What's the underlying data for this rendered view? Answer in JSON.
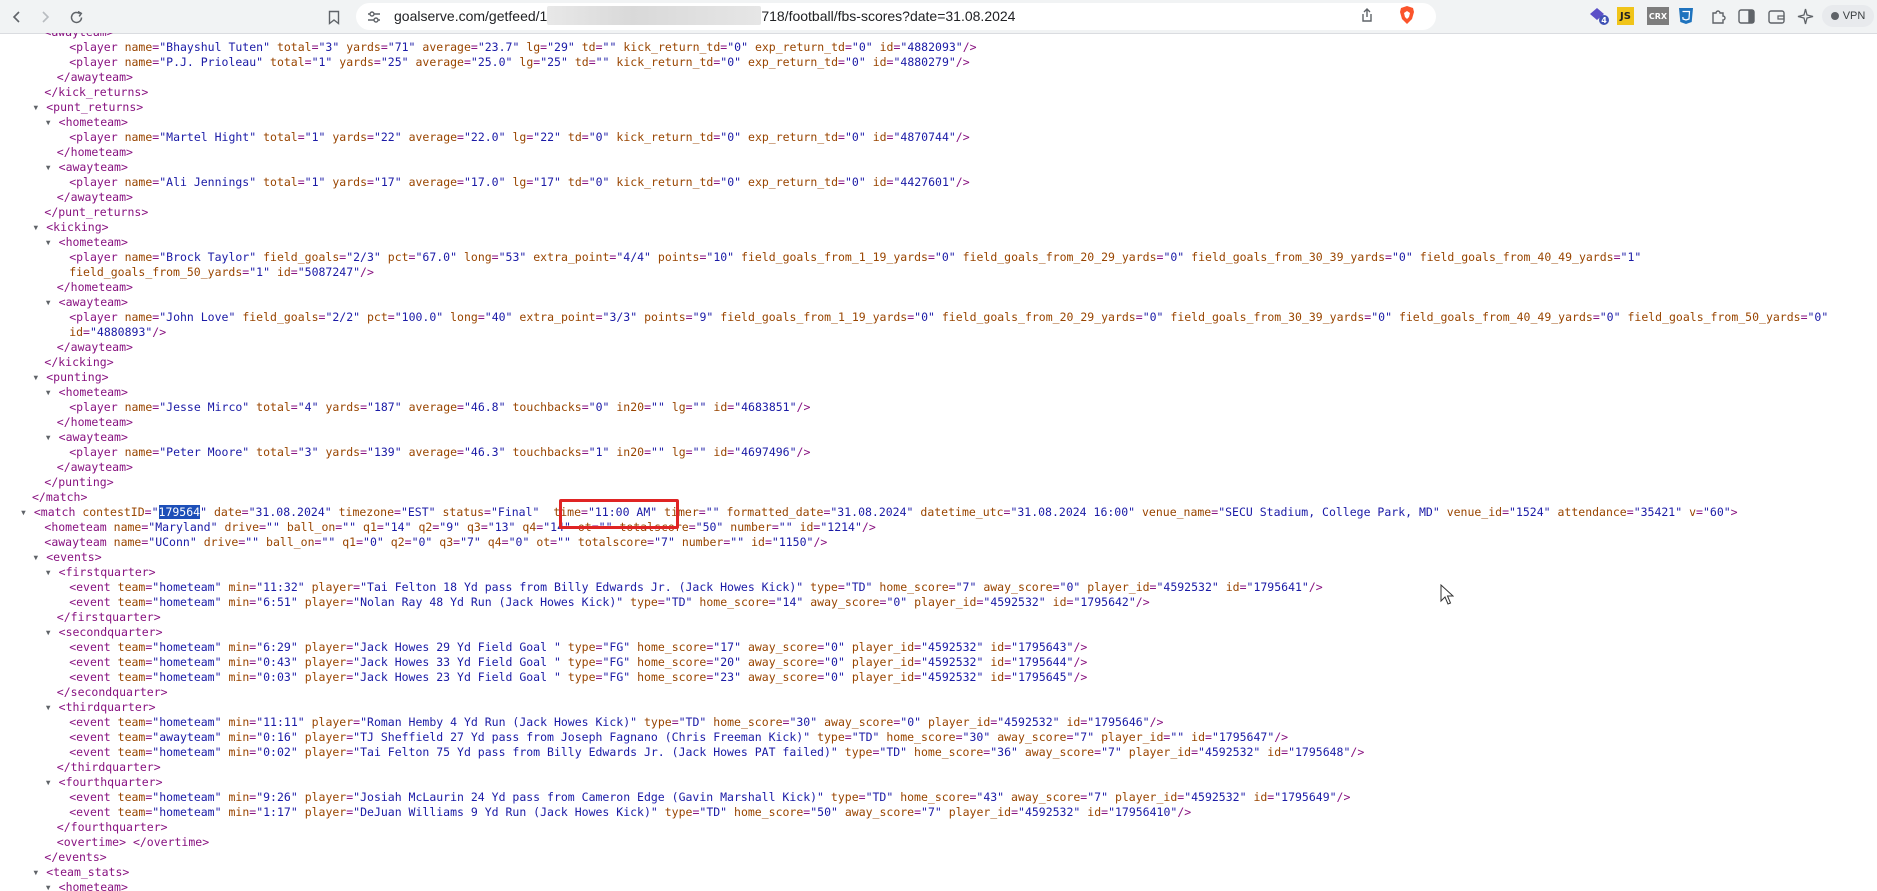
{
  "browser": {
    "url_prefix": "goalserve.com/getfeed/1",
    "url_suffix": "718/football/fbs-scores?date=31.08.2024",
    "extensions": [
      {
        "name": "extension-badge-icon",
        "badge": "4",
        "color": "#5b4fc7"
      },
      {
        "name": "js-extension-icon",
        "label": "JS",
        "color": "#f0c419"
      },
      {
        "name": "crx-extension-icon",
        "label": "CRX",
        "color": "#7d7d7d"
      },
      {
        "name": "css3-extension-icon",
        "color": "#1e73be"
      },
      {
        "name": "puzzle-extensions-icon",
        "color": "#5f6368"
      },
      {
        "name": "sidebar-icon",
        "color": "#5f6368"
      },
      {
        "name": "wallet-icon",
        "color": "#5f6368"
      },
      {
        "name": "leo-ai-icon",
        "color": "#5f6368"
      }
    ],
    "vpn_label": "VPN"
  },
  "xml_lines": [
    {
      "indent": 4,
      "text": "<awayteam>",
      "cut": true
    },
    {
      "indent": 6,
      "text": "<player name=\"Bhayshul Tuten\" total=\"3\" yards=\"71\" average=\"23.7\" lg=\"29\" td=\"\" kick_return_td=\"0\" exp_return_td=\"0\" id=\"4882093\"/>"
    },
    {
      "indent": 6,
      "text": "<player name=\"P.J. Prioleau\" total=\"1\" yards=\"25\" average=\"25.0\" lg=\"25\" td=\"\" kick_return_td=\"0\" exp_return_td=\"0\" id=\"4880279\"/>"
    },
    {
      "indent": 5,
      "text": "</awayteam>"
    },
    {
      "indent": 4,
      "text": "</kick_returns>"
    },
    {
      "indent": 4,
      "text": "<punt_returns>",
      "tri": true
    },
    {
      "indent": 5,
      "text": "<hometeam>",
      "tri": true
    },
    {
      "indent": 6,
      "text": "<player name=\"Martel Hight\" total=\"1\" yards=\"22\" average=\"22.0\" lg=\"22\" td=\"0\" kick_return_td=\"0\" exp_return_td=\"0\" id=\"4870744\"/>"
    },
    {
      "indent": 5,
      "text": "</hometeam>"
    },
    {
      "indent": 5,
      "text": "<awayteam>",
      "tri": true
    },
    {
      "indent": 6,
      "text": "<player name=\"Ali Jennings\" total=\"1\" yards=\"17\" average=\"17.0\" lg=\"17\" td=\"0\" kick_return_td=\"0\" exp_return_td=\"0\" id=\"4427601\"/>"
    },
    {
      "indent": 5,
      "text": "</awayteam>"
    },
    {
      "indent": 4,
      "text": "</punt_returns>"
    },
    {
      "indent": 4,
      "text": "<kicking>",
      "tri": true
    },
    {
      "indent": 5,
      "text": "<hometeam>",
      "tri": true
    },
    {
      "indent": 6,
      "text": "<player name=\"Brock Taylor\" field_goals=\"2/3\" pct=\"67.0\" long=\"53\" extra_point=\"4/4\" points=\"10\" field_goals_from_1_19_yards=\"0\" field_goals_from_20_29_yards=\"0\" field_goals_from_30_39_yards=\"0\" field_goals_from_40_49_yards=\"1\""
    },
    {
      "indent": 6,
      "text": "field_goals_from_50_yards=\"1\" id=\"5087247\"/>"
    },
    {
      "indent": 5,
      "text": "</hometeam>"
    },
    {
      "indent": 5,
      "text": "<awayteam>",
      "tri": true
    },
    {
      "indent": 6,
      "text": "<player name=\"John Love\" field_goals=\"2/2\" pct=\"100.0\" long=\"40\" extra_point=\"3/3\" points=\"9\" field_goals_from_1_19_yards=\"0\" field_goals_from_20_29_yards=\"0\" field_goals_from_30_39_yards=\"0\" field_goals_from_40_49_yards=\"0\" field_goals_from_50_yards=\"0\""
    },
    {
      "indent": 6,
      "text": "id=\"4880893\"/>"
    },
    {
      "indent": 5,
      "text": "</awayteam>"
    },
    {
      "indent": 4,
      "text": "</kicking>"
    },
    {
      "indent": 4,
      "text": "<punting>",
      "tri": true
    },
    {
      "indent": 5,
      "text": "<hometeam>",
      "tri": true
    },
    {
      "indent": 6,
      "text": "<player name=\"Jesse Mirco\" total=\"4\" yards=\"187\" average=\"46.8\" touchbacks=\"0\" in20=\"\" lg=\"\" id=\"4683851\"/>"
    },
    {
      "indent": 5,
      "text": "</hometeam>"
    },
    {
      "indent": 5,
      "text": "<awayteam>",
      "tri": true
    },
    {
      "indent": 6,
      "text": "<player name=\"Peter Moore\" total=\"3\" yards=\"139\" average=\"46.3\" touchbacks=\"1\" in20=\"\" lg=\"\" id=\"4697496\"/>"
    },
    {
      "indent": 5,
      "text": "</awayteam>"
    },
    {
      "indent": 4,
      "text": "</punting>"
    },
    {
      "indent": 3,
      "text": "</match>"
    },
    {
      "indent": 3,
      "text": "<match contestID=\"179564\" date=\"31.08.2024\" timezone=\"EST\" status=\"Final\"  time=\"11:00 AM\" timer=\"\" formatted_date=\"31.08.2024\" datetime_utc=\"31.08.2024 16:00\" venue_name=\"SECU Stadium, College Park, MD\" venue_id=\"1524\" attendance=\"35421\" v=\"60\">",
      "tri": true,
      "highlight": "179564"
    },
    {
      "indent": 4,
      "text": "<hometeam name=\"Maryland\" drive=\"\" ball_on=\"\" q1=\"14\" q2=\"9\" q3=\"13\" q4=\"14\" ot=\"\" totalscore=\"50\" number=\"\" id=\"1214\"/>"
    },
    {
      "indent": 4,
      "text": "<awayteam name=\"UConn\" drive=\"\" ball_on=\"\" q1=\"0\" q2=\"0\" q3=\"7\" q4=\"0\" ot=\"\" totalscore=\"7\" number=\"\" id=\"1150\"/>"
    },
    {
      "indent": 4,
      "text": "<events>",
      "tri": true
    },
    {
      "indent": 5,
      "text": "<firstquarter>",
      "tri": true
    },
    {
      "indent": 6,
      "text": "<event team=\"hometeam\" min=\"11:32\" player=\"Tai Felton 18 Yd pass from Billy Edwards Jr. (Jack Howes Kick)\" type=\"TD\" home_score=\"7\" away_score=\"0\" player_id=\"4592532\" id=\"1795641\"/>"
    },
    {
      "indent": 6,
      "text": "<event team=\"hometeam\" min=\"6:51\" player=\"Nolan Ray 48 Yd Run (Jack Howes Kick)\" type=\"TD\" home_score=\"14\" away_score=\"0\" player_id=\"4592532\" id=\"1795642\"/>"
    },
    {
      "indent": 5,
      "text": "</firstquarter>"
    },
    {
      "indent": 5,
      "text": "<secondquarter>",
      "tri": true
    },
    {
      "indent": 6,
      "text": "<event team=\"hometeam\" min=\"6:29\" player=\"Jack Howes 29 Yd Field Goal \" type=\"FG\" home_score=\"17\" away_score=\"0\" player_id=\"4592532\" id=\"1795643\"/>"
    },
    {
      "indent": 6,
      "text": "<event team=\"hometeam\" min=\"0:43\" player=\"Jack Howes 33 Yd Field Goal \" type=\"FG\" home_score=\"20\" away_score=\"0\" player_id=\"4592532\" id=\"1795644\"/>"
    },
    {
      "indent": 6,
      "text": "<event team=\"hometeam\" min=\"0:03\" player=\"Jack Howes 23 Yd Field Goal \" type=\"FG\" home_score=\"23\" away_score=\"0\" player_id=\"4592532\" id=\"1795645\"/>"
    },
    {
      "indent": 5,
      "text": "</secondquarter>"
    },
    {
      "indent": 5,
      "text": "<thirdquarter>",
      "tri": true
    },
    {
      "indent": 6,
      "text": "<event team=\"hometeam\" min=\"11:11\" player=\"Roman Hemby 4 Yd Run (Jack Howes Kick)\" type=\"TD\" home_score=\"30\" away_score=\"0\" player_id=\"4592532\" id=\"1795646\"/>"
    },
    {
      "indent": 6,
      "text": "<event team=\"awayteam\" min=\"0:16\" player=\"TJ Sheffield 27 Yd pass from Joseph Fagnano (Chris Freeman Kick)\" type=\"TD\" home_score=\"30\" away_score=\"7\" player_id=\"\" id=\"1795647\"/>"
    },
    {
      "indent": 6,
      "text": "<event team=\"hometeam\" min=\"0:02\" player=\"Tai Felton 75 Yd pass from Billy Edwards Jr. (Jack Howes PAT failed)\" type=\"TD\" home_score=\"36\" away_score=\"7\" player_id=\"4592532\" id=\"1795648\"/>"
    },
    {
      "indent": 5,
      "text": "</thirdquarter>"
    },
    {
      "indent": 5,
      "text": "<fourthquarter>",
      "tri": true
    },
    {
      "indent": 6,
      "text": "<event team=\"hometeam\" min=\"9:26\" player=\"Josiah McLaurin 24 Yd pass from Cameron Edge (Gavin Marshall Kick)\" type=\"TD\" home_score=\"43\" away_score=\"7\" player_id=\"4592532\" id=\"1795649\"/>"
    },
    {
      "indent": 6,
      "text": "<event team=\"hometeam\" min=\"1:17\" player=\"DeJuan Williams 9 Yd Run (Jack Howes Kick)\" type=\"TD\" home_score=\"50\" away_score=\"7\" player_id=\"4592532\" id=\"17956410\"/>"
    },
    {
      "indent": 5,
      "text": "</fourthquarter>"
    },
    {
      "indent": 5,
      "text": "<overtime> </overtime>"
    },
    {
      "indent": 4,
      "text": "</events>"
    },
    {
      "indent": 4,
      "text": "<team_stats>",
      "tri": true
    },
    {
      "indent": 5,
      "text": "<hometeam>",
      "tri": true,
      "cut": true
    }
  ],
  "annotation": {
    "boxed_text": "time=\"11:00 AM\"",
    "box_color": "#e02424"
  }
}
